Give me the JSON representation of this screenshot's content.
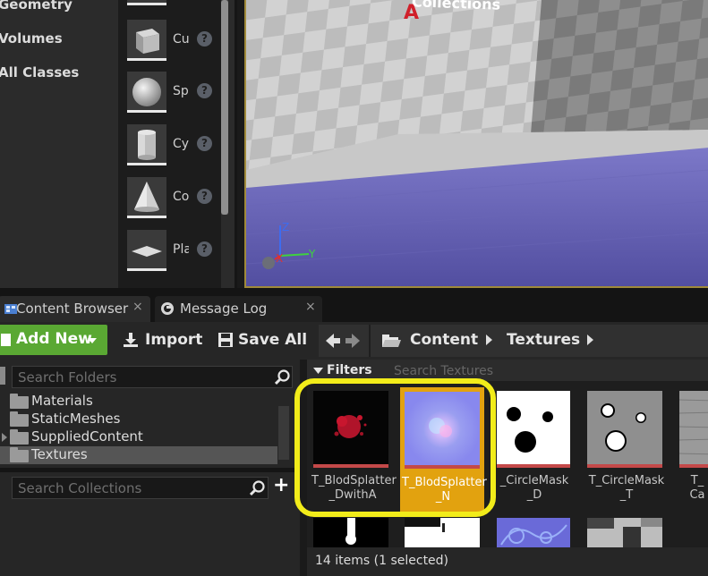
{
  "place_panel": {
    "categories": [
      "Geometry",
      "Volumes",
      "All Classes"
    ],
    "items": [
      {
        "label": "Cu",
        "icon": "cube-icon"
      },
      {
        "label": "Sp",
        "icon": "sphere-icon"
      },
      {
        "label": "Cy",
        "icon": "cylinder-icon"
      },
      {
        "label": "Co",
        "icon": "cone-icon"
      },
      {
        "label": "Pla",
        "icon": "plane-icon"
      }
    ],
    "help_glyph": "?"
  },
  "viewport": {
    "overlay_text": "Collections",
    "marker": "A",
    "axis_labels": {
      "x": "X",
      "y": "Y",
      "z": "Z"
    }
  },
  "tabs": [
    {
      "label": "Content Browser",
      "icon": "content-browser-icon",
      "close": "×"
    },
    {
      "label": "Message Log",
      "icon": "message-log-icon",
      "close": "×"
    }
  ],
  "toolbar": {
    "add_new": "Add New",
    "import": "Import",
    "save_all": "Save All",
    "breadcrumb": [
      "Content",
      "Textures"
    ]
  },
  "sources": {
    "search_folders_placeholder": "Search Folders",
    "folders": [
      {
        "label": "Materials",
        "expandable": false,
        "selected": false
      },
      {
        "label": "StaticMeshes",
        "expandable": false,
        "selected": false
      },
      {
        "label": "SuppliedContent",
        "expandable": true,
        "selected": false
      },
      {
        "label": "Textures",
        "expandable": false,
        "selected": true
      }
    ],
    "search_collections_placeholder": "Search Collections",
    "add_collection_glyph": "+"
  },
  "assets": {
    "filters_label": "Filters",
    "search_placeholder": "Search Textures",
    "tiles": [
      {
        "name": "T_BlodSplatter\n_DwithA",
        "selected": false
      },
      {
        "name": "T_BlodSplatter\n_N",
        "selected": true
      },
      {
        "name": "_CircleMask\n_D",
        "selected": false
      },
      {
        "name": "T_CircleMask\n_T",
        "selected": false
      },
      {
        "name": "T_\nCa",
        "selected": false
      }
    ],
    "status": "14 items (1 selected)"
  },
  "colors": {
    "accent_green": "#5aa833",
    "selection_orange": "#e2a20f",
    "highlight_yellow": "#f2ec1a",
    "texture_bar_red": "#c44949"
  }
}
